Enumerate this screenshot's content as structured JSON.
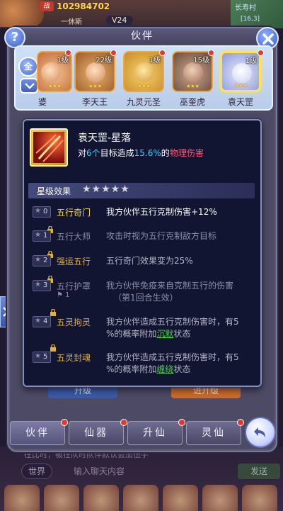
{
  "hud": {
    "power_label": "战",
    "power_value": "102984702",
    "player_name": "一休斯",
    "vip": "V24",
    "location": "长寿村",
    "coords": "[16,3]"
  },
  "panel": {
    "title": "伙伴",
    "filter_all_label": "全"
  },
  "heroes": [
    {
      "name": "婆",
      "level": "1级",
      "stars": "★★★"
    },
    {
      "name": "李天王",
      "level": "22级",
      "stars": "★★★"
    },
    {
      "name": "九灵元圣",
      "level": "1级",
      "stars": "★★★"
    },
    {
      "name": "巫奎虎",
      "level": "15级",
      "stars": "★★★"
    },
    {
      "name": "袁天罡",
      "level": "1级",
      "stars": "★★★",
      "selected": true
    }
  ],
  "skill": {
    "title": "袁天罡-星落",
    "desc_prefix": "对",
    "desc_targets": "6个",
    "desc_mid": "目标造成",
    "desc_percent": "15.6%",
    "desc_of": "的",
    "desc_type": "物理伤害"
  },
  "star_effects": {
    "header": "星级效果",
    "header_stars": "★★★★★",
    "rows": [
      {
        "level": "0",
        "name": "五行奇门",
        "desc": "我方伙伴五行克制伤害+12%"
      },
      {
        "level": "1",
        "name": "五行大师",
        "desc": "攻击时视为五行克制敌方目标"
      },
      {
        "level": "2",
        "name": "强运五行",
        "desc": "五行奇门效果变为25%"
      },
      {
        "level": "3",
        "name": "五行护罩",
        "sub": "1",
        "desc_line1": "我方伙伴免疫来自克制五行的伤害",
        "desc_line2": "（第1回合生效）"
      },
      {
        "level": "4",
        "name": "五灵拘灵",
        "desc_line1": "我方伙伴造成五行克制伤害时，有5",
        "desc_line2_pre": "%的概率附加",
        "desc_line2_link": "沉默",
        "desc_line2_post": "状态"
      },
      {
        "level": "5",
        "name": "五灵封魂",
        "desc_line1": "我方伙伴造成五行克制伤害时，有5",
        "desc_line2_pre": "%的概率附加",
        "desc_line2_link": "缠绕",
        "desc_line2_post": "状态"
      }
    ]
  },
  "under_buttons": {
    "upgrade": "升级",
    "star_up": "进升级"
  },
  "tabs": [
    {
      "label": "伙伴"
    },
    {
      "label": "仙器"
    },
    {
      "label": "升仙"
    },
    {
      "label": "灵仙"
    }
  ],
  "chat": {
    "line": "在比时，被在队时队伴默认会加伍手",
    "channel": "世界",
    "placeholder": "输入聊天内容",
    "send": "发送"
  },
  "colors": {
    "accent_cyan": "#38d3ff",
    "damage_pink": "#ff5a7a",
    "active_gold": "#ffd84a",
    "status_green": "#4fd14f"
  }
}
